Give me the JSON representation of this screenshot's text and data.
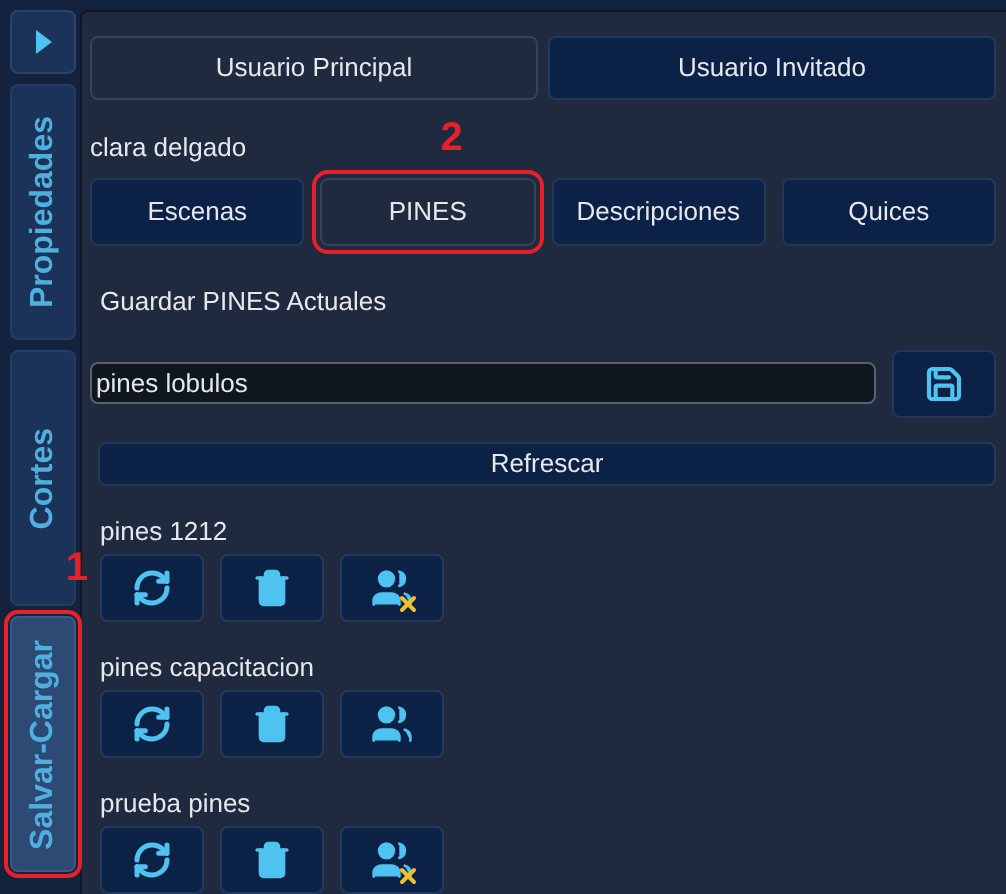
{
  "sidebar": {
    "tabs": [
      {
        "label": "Propiedades",
        "selected": false
      },
      {
        "label": "Cortes",
        "selected": false
      },
      {
        "label": "Salvar-Cargar",
        "selected": true,
        "callout": "1"
      }
    ]
  },
  "users": [
    {
      "label": "Usuario Principal",
      "selected": true
    },
    {
      "label": "Usuario Invitado",
      "selected": false
    }
  ],
  "current_user": "clara delgado",
  "tabs": [
    {
      "label": "Escenas",
      "selected": false
    },
    {
      "label": "PINES",
      "selected": true,
      "callout": "2"
    },
    {
      "label": "Descripciones",
      "selected": false
    },
    {
      "label": "Quices",
      "selected": false
    }
  ],
  "save_label": "Guardar PINES Actuales",
  "name_field": {
    "value": "pines lobulos"
  },
  "refresh_button": "Refrescar",
  "saves": [
    {
      "name": "pines 1212",
      "marked": true
    },
    {
      "name": "pines capacitacion",
      "marked": false
    },
    {
      "name": "prueba pines",
      "marked": true
    }
  ]
}
